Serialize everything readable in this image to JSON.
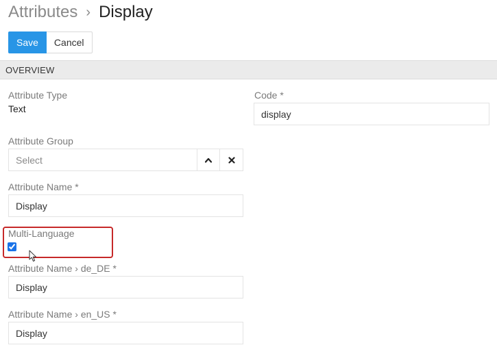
{
  "header": {
    "parent": "Attributes",
    "separator": "›",
    "current": "Display"
  },
  "toolbar": {
    "save_label": "Save",
    "cancel_label": "Cancel"
  },
  "section": {
    "title": "OVERVIEW"
  },
  "fields": {
    "attribute_type": {
      "label": "Attribute Type",
      "value": "Text"
    },
    "code": {
      "label": "Code *",
      "value": "display"
    },
    "attribute_group": {
      "label": "Attribute Group",
      "placeholder": "Select"
    },
    "attribute_name": {
      "label": "Attribute Name *",
      "value": "Display"
    },
    "multi_language": {
      "label": "Multi-Language",
      "checked": true
    },
    "attribute_name_de": {
      "label": "Attribute Name › de_DE *",
      "value": "Display"
    },
    "attribute_name_en": {
      "label": "Attribute Name › en_US *",
      "value": "Display"
    }
  },
  "colors": {
    "primary": "#2895e6",
    "highlight": "#c62828",
    "section_bg": "#ebebeb"
  },
  "icons": {
    "expand": "chevron-up-icon",
    "clear": "close-icon",
    "pointer": "mouse-cursor-icon"
  }
}
